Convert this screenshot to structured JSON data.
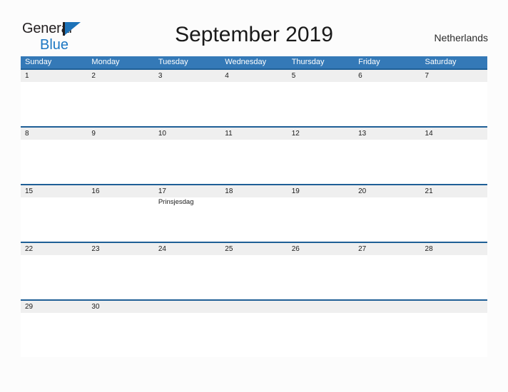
{
  "brand": {
    "line1": "General",
    "line2": "Blue",
    "mark_icon": "flag-triangle-icon",
    "accent_color": "#1c77c3",
    "dark_color": "#231f20"
  },
  "header": {
    "title": "September 2019",
    "region": "Netherlands"
  },
  "calendar": {
    "header_bg": "#3479b7",
    "band_bg": "#efefef",
    "row_border": "#1f5f96",
    "day_names": [
      "Sunday",
      "Monday",
      "Tuesday",
      "Wednesday",
      "Thursday",
      "Friday",
      "Saturday"
    ],
    "weeks": [
      {
        "days": [
          {
            "num": "1",
            "event": ""
          },
          {
            "num": "2",
            "event": ""
          },
          {
            "num": "3",
            "event": ""
          },
          {
            "num": "4",
            "event": ""
          },
          {
            "num": "5",
            "event": ""
          },
          {
            "num": "6",
            "event": ""
          },
          {
            "num": "7",
            "event": ""
          }
        ]
      },
      {
        "days": [
          {
            "num": "8",
            "event": ""
          },
          {
            "num": "9",
            "event": ""
          },
          {
            "num": "10",
            "event": ""
          },
          {
            "num": "11",
            "event": ""
          },
          {
            "num": "12",
            "event": ""
          },
          {
            "num": "13",
            "event": ""
          },
          {
            "num": "14",
            "event": ""
          }
        ]
      },
      {
        "days": [
          {
            "num": "15",
            "event": ""
          },
          {
            "num": "16",
            "event": ""
          },
          {
            "num": "17",
            "event": "Prinsjesdag"
          },
          {
            "num": "18",
            "event": ""
          },
          {
            "num": "19",
            "event": ""
          },
          {
            "num": "20",
            "event": ""
          },
          {
            "num": "21",
            "event": ""
          }
        ]
      },
      {
        "days": [
          {
            "num": "22",
            "event": ""
          },
          {
            "num": "23",
            "event": ""
          },
          {
            "num": "24",
            "event": ""
          },
          {
            "num": "25",
            "event": ""
          },
          {
            "num": "26",
            "event": ""
          },
          {
            "num": "27",
            "event": ""
          },
          {
            "num": "28",
            "event": ""
          }
        ]
      },
      {
        "days": [
          {
            "num": "29",
            "event": ""
          },
          {
            "num": "30",
            "event": ""
          },
          {
            "num": "",
            "event": ""
          },
          {
            "num": "",
            "event": ""
          },
          {
            "num": "",
            "event": ""
          },
          {
            "num": "",
            "event": ""
          },
          {
            "num": "",
            "event": ""
          }
        ]
      }
    ]
  }
}
